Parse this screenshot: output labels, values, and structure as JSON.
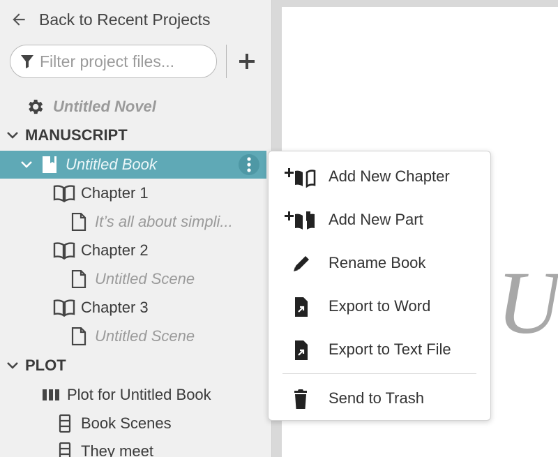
{
  "sidebar": {
    "back_label": "Back to Recent Projects",
    "filter_placeholder": "Filter project files...",
    "tree": {
      "project_title": "Untitled Novel",
      "manuscript_header": "MANUSCRIPT",
      "book_title": "Untitled Book",
      "chapters": [
        {
          "label": "Chapter 1",
          "scene": "It’s all about simpli..."
        },
        {
          "label": "Chapter 2",
          "scene": "Untitled Scene"
        },
        {
          "label": "Chapter 3",
          "scene": "Untitled Scene"
        }
      ],
      "plot_header": "PLOT",
      "plot_items": [
        {
          "label": "Plot for Untitled Book",
          "icon": "columns-icon"
        },
        {
          "label": "Book Scenes",
          "icon": "card-stack-icon"
        },
        {
          "label": "They meet",
          "icon": "card-stack-icon"
        }
      ]
    }
  },
  "context_menu": {
    "items": [
      {
        "label": "Add New Chapter",
        "icon": "add-chapter-icon"
      },
      {
        "label": "Add New Part",
        "icon": "add-part-icon"
      },
      {
        "label": "Rename Book",
        "icon": "pencil-icon"
      },
      {
        "label": "Export to Word",
        "icon": "export-file-icon"
      },
      {
        "label": "Export to Text File",
        "icon": "export-file-icon"
      },
      {
        "label": "Send to Trash",
        "icon": "trash-icon"
      }
    ]
  },
  "editor": {
    "title_initial": "U"
  },
  "colors": {
    "selection": "#5fa9b6",
    "sidebar_bg": "#f0f0f0",
    "muted_text": "#9a9a9a"
  }
}
